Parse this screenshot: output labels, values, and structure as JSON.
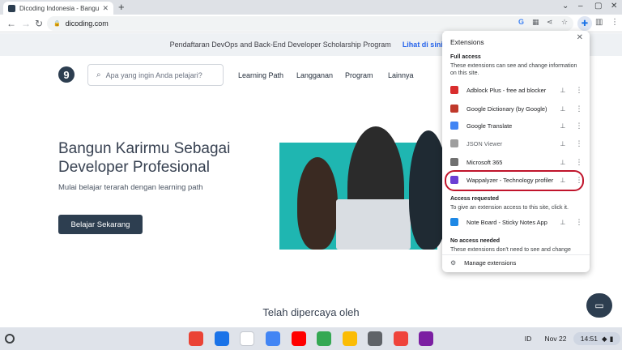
{
  "browser": {
    "tab_title": "Dicoding Indonesia - Bangun Ka",
    "new_tab": "+",
    "url": "dicoding.com",
    "window_controls": [
      "⌄",
      "–",
      "▢",
      "✕"
    ]
  },
  "page": {
    "announcement": "Pendaftaran DevOps and Back-End Developer Scholarship Program",
    "announcement_link": "Lihat di sini →",
    "logo": "9",
    "search_placeholder": "Apa yang ingin Anda pelajari?",
    "nav": [
      "Learning Path",
      "Langganan",
      "Program",
      "Lainnya"
    ],
    "hero_title": "Bangun Karirmu Sebagai Developer Profesional",
    "hero_subtitle": "Mulai belajar terarah dengan learning path",
    "cta": "Belajar Sekarang",
    "trusted": "Telah dipercaya oleh"
  },
  "extensions_popup": {
    "title": "Extensions",
    "full_access_title": "Full access",
    "full_access_desc": "These extensions can see and change information on this site.",
    "full_access_items": [
      {
        "name": "Adblock Plus - free ad blocker",
        "icon": "adblock-icon",
        "color": "#d92d2d"
      },
      {
        "name": "Google Dictionary (by Google)",
        "icon": "dictionary-icon",
        "color": "#c0392b"
      },
      {
        "name": "Google Translate",
        "icon": "translate-icon",
        "color": "#4285f4"
      },
      {
        "name": "JSON Viewer",
        "icon": "json-icon",
        "color": "#9e9e9e"
      },
      {
        "name": "Microsoft 365",
        "icon": "microsoft-365-icon",
        "color": "#707070"
      },
      {
        "name": "Wappalyzer - Technology profiler",
        "icon": "wappalyzer-icon",
        "color": "#6b3fd4"
      }
    ],
    "access_requested_title": "Access requested",
    "access_requested_desc": "To give an extension access to this site, click it.",
    "access_requested_items": [
      {
        "name": "Note Board - Sticky Notes App",
        "icon": "note-board-icon",
        "color": "#1e88e5"
      }
    ],
    "no_access_title": "No access needed",
    "no_access_desc": "These extensions don't need to see and change",
    "manage": "Manage extensions"
  },
  "shelf": {
    "apps": [
      {
        "name": "chrome-icon",
        "color": "#ea4335"
      },
      {
        "name": "files-icon",
        "color": "#1a73e8"
      },
      {
        "name": "gmail-icon",
        "color": "#ffffff"
      },
      {
        "name": "docs-icon",
        "color": "#4285f4"
      },
      {
        "name": "youtube-icon",
        "color": "#ff0000"
      },
      {
        "name": "play-store-icon",
        "color": "#34a853"
      },
      {
        "name": "keep-icon",
        "color": "#fbbc04"
      },
      {
        "name": "photos-icon",
        "color": "#5f6368"
      },
      {
        "name": "anydesk-icon",
        "color": "#ef443b"
      },
      {
        "name": "k-app-icon",
        "color": "#7b1fa2"
      }
    ],
    "ime": "ID",
    "date": "Nov 22",
    "time": "14:51"
  }
}
